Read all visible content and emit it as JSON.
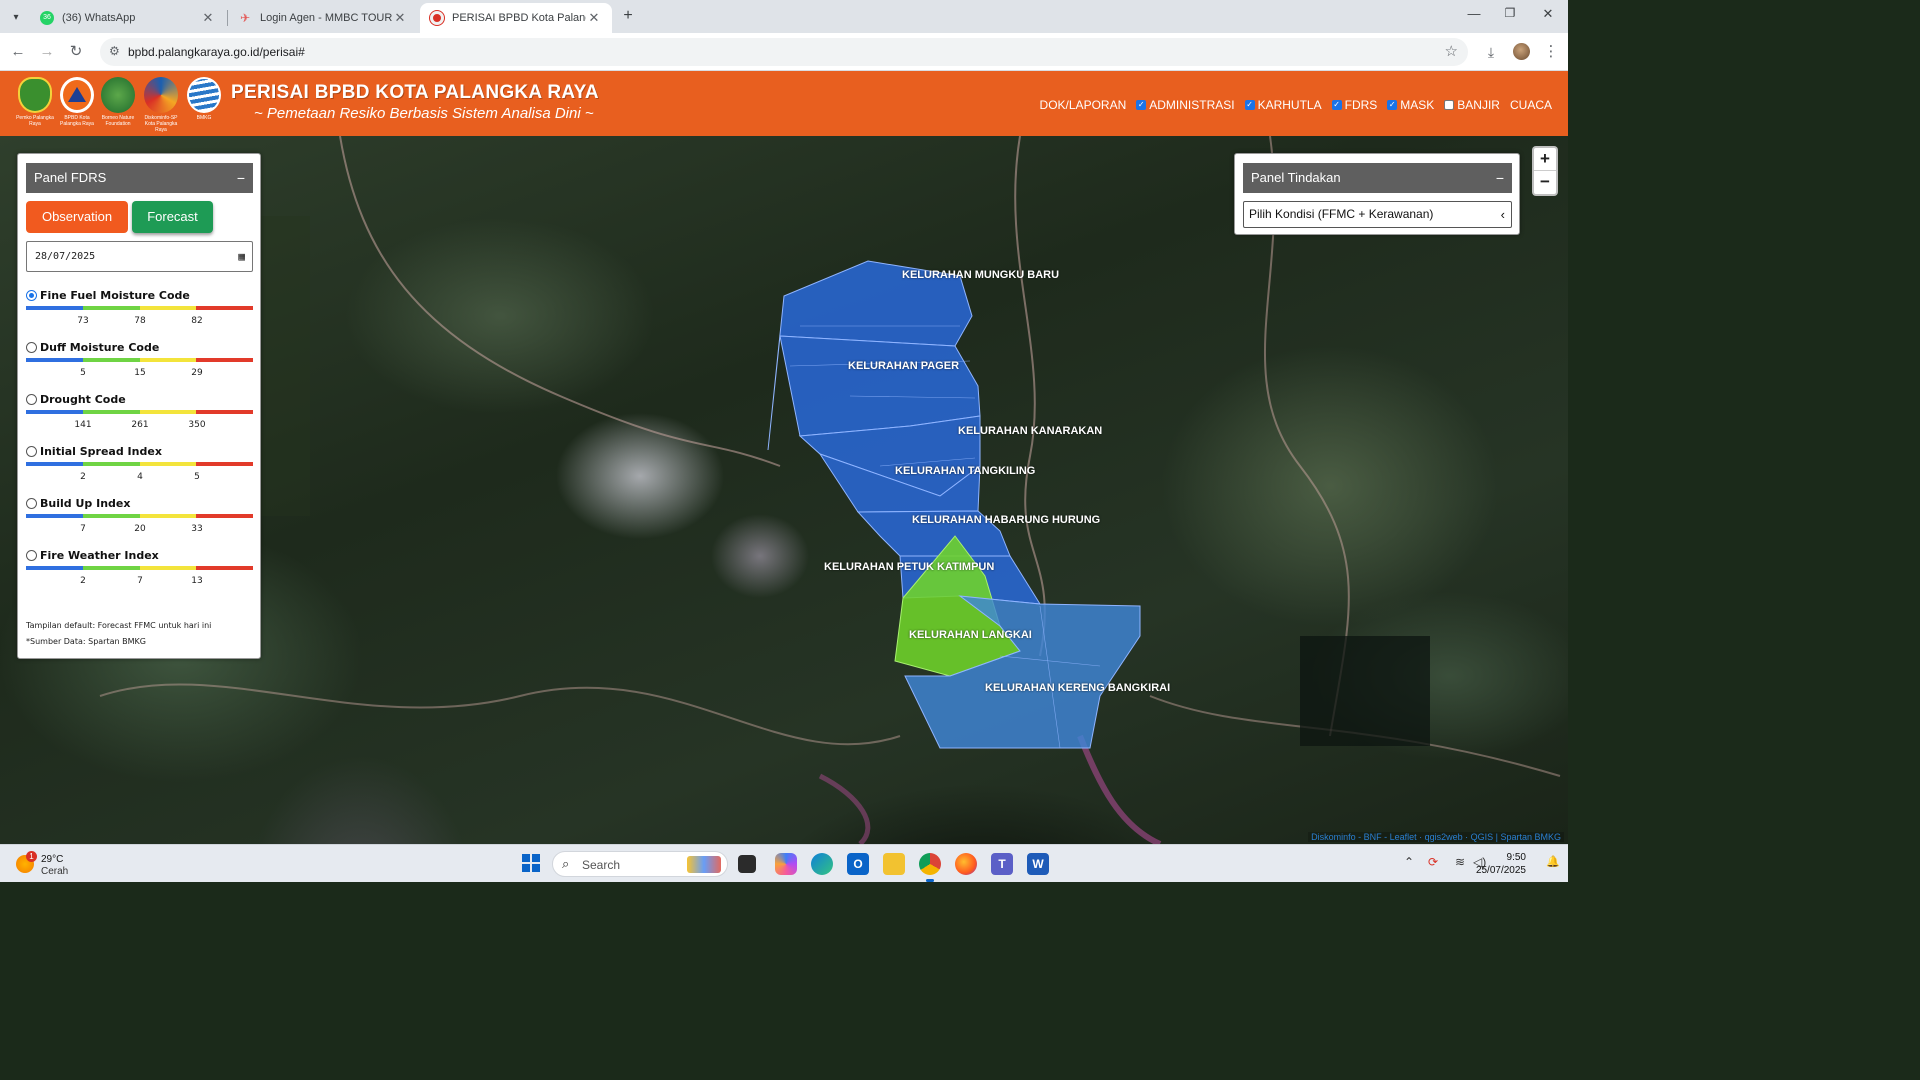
{
  "browser": {
    "tabs": [
      {
        "label": "(36) WhatsApp",
        "favicon_color": "#25d366",
        "favicon_text": "36"
      },
      {
        "label": "Login Agen - MMBC TOUR TRA",
        "favicon_color": "#e35d5b"
      },
      {
        "label": "PERISAI BPBD Kota Palangka Ra",
        "favicon_color": "#d93025",
        "active": true
      }
    ],
    "url": "bpbd.palangkaraya.go.id/perisai#"
  },
  "header": {
    "title": "PERISAI BPBD KOTA PALANGKA RAYA",
    "subtitle": "~ Pemetaan Resiko Berbasis Sistem Analisa Dini ~",
    "logos": [
      {
        "caption": "Pemko Palangka Raya",
        "color": "#3a8f2e"
      },
      {
        "caption": "BPBD Kota Palangka Raya",
        "color": "#f06a1b"
      },
      {
        "caption": "Borneo Nature Foundation",
        "color": "#2d8a3c"
      },
      {
        "caption": "Diskominfo-SP Kota Palangka Raya",
        "color": "#1b5fb0"
      },
      {
        "caption": "BMKG",
        "color": "#2a78c8"
      }
    ],
    "nav": [
      {
        "label": "DOK/LAPORAN",
        "checkbox": null
      },
      {
        "label": "ADMINISTRASI",
        "checkbox": true
      },
      {
        "label": "KARHUTLA",
        "checkbox": true
      },
      {
        "label": "FDRS",
        "checkbox": true
      },
      {
        "label": "MASK",
        "checkbox": true
      },
      {
        "label": "BANJIR",
        "checkbox": false
      },
      {
        "label": "CUACA",
        "checkbox": null
      }
    ]
  },
  "fdrs_panel": {
    "title": "Panel FDRS",
    "btn_observation": "Observation",
    "btn_forecast": "Forecast",
    "date_value": "28/07/2025",
    "bar_colors": [
      "#2f6fe0",
      "#6fd444",
      "#f3e43b",
      "#e23a2a"
    ],
    "indices": [
      {
        "name": "Fine Fuel Moisture Code",
        "selected": true,
        "ticks": [
          "73",
          "78",
          "82"
        ]
      },
      {
        "name": "Duff Moisture Code",
        "selected": false,
        "ticks": [
          "5",
          "15",
          "29"
        ]
      },
      {
        "name": "Drought Code",
        "selected": false,
        "ticks": [
          "141",
          "261",
          "350"
        ]
      },
      {
        "name": "Initial Spread Index",
        "selected": false,
        "ticks": [
          "2",
          "4",
          "5"
        ]
      },
      {
        "name": "Build Up Index",
        "selected": false,
        "ticks": [
          "7",
          "20",
          "33"
        ]
      },
      {
        "name": "Fire Weather Index",
        "selected": false,
        "ticks": [
          "2",
          "7",
          "13"
        ]
      }
    ],
    "note_default": "Tampilan default: Forecast FFMC untuk hari ini",
    "note_source": "*Sumber Data: Spartan BMKG"
  },
  "tindakan_panel": {
    "title": "Panel Tindakan",
    "select_value": "Pilih Kondisi (FFMC + Kerawanan)"
  },
  "map": {
    "zoom_in": "+",
    "zoom_out": "−",
    "attribution": "Diskominfo - BNF - Leaflet · qgis2web · QGIS | Spartan BMKG",
    "kelurahan": [
      {
        "name": "KELURAHAN MUNGKU BARU",
        "fill": "#2a6be0"
      },
      {
        "name": "KELURAHAN PAGER",
        "fill": "#2a6be0"
      },
      {
        "name": "KELURAHAN KANARAKAN",
        "fill": "#2a6be0"
      },
      {
        "name": "KELURAHAN TANGKILING",
        "fill": "#2a6be0"
      },
      {
        "name": "KELURAHAN HABARUNG HURUNG",
        "fill": "#2a6be0"
      },
      {
        "name": "KELURAHAN PETUK KATIMPUN",
        "fill": "#2a6be0"
      },
      {
        "name": "KELURAHAN LANGKAI",
        "fill": "#6fd42a"
      },
      {
        "name": "KELURAHAN KERENG BANGKIRAI",
        "fill": "#3f86d8"
      }
    ]
  },
  "taskbar": {
    "weather_temp": "29°C",
    "weather_cond": "Cerah",
    "weather_badge": "1",
    "search_placeholder": "Search",
    "time": "9:50",
    "date": "25/07/2025"
  }
}
